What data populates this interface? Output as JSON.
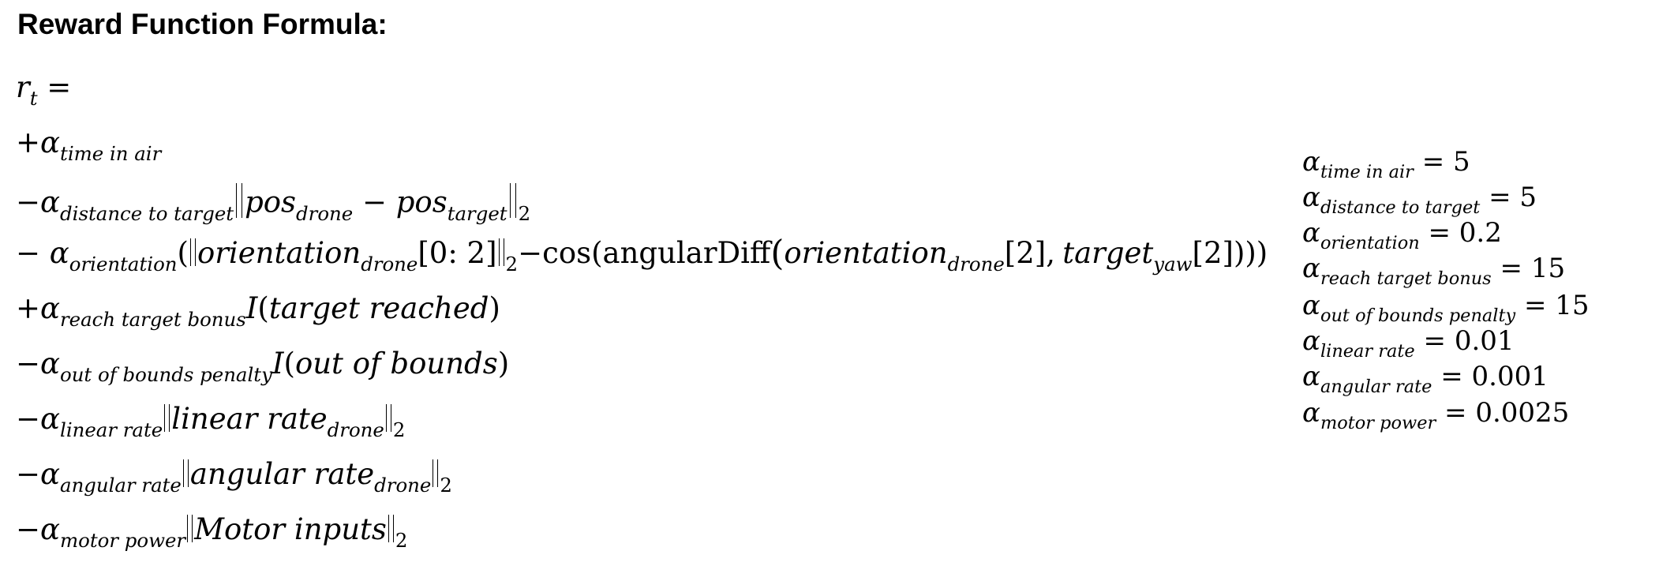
{
  "heading": "Reward Function Formula:",
  "formula": {
    "reward": {
      "symbol": "r",
      "subscript": "t",
      "equals": "="
    },
    "alpha": "α",
    "time_in_air": {
      "sign": "+",
      "subscript": "time in air"
    },
    "distance": {
      "sign": "−",
      "subscript": "distance to target",
      "pos": "pos",
      "drone": "drone",
      "minus": "−",
      "target": "target",
      "norm": "2"
    },
    "orientation": {
      "sign": "−",
      "subscript": "orientation",
      "open_paren": "(",
      "orient": "orientation",
      "drone": "drone",
      "slice": "[0: 2]",
      "norm": "2",
      "minus": "−",
      "cos": "cos",
      "fn": "angularDiff",
      "orient2": "orientation",
      "drone2": "drone",
      "idx": "[2],",
      "target": "target",
      "yaw": "yaw",
      "idx2": "[2]",
      "close": ")))"
    },
    "reach_target": {
      "sign": "+",
      "subscript": "reach target bonus",
      "indicator": "I",
      "open": "(",
      "arg": "target reached",
      "close": ")"
    },
    "out_of_bounds": {
      "sign": "−",
      "subscript": "out of bounds penalty",
      "indicator": "I",
      "open": "(",
      "arg": "out of bounds",
      "close": ")"
    },
    "linear_rate": {
      "sign": "−",
      "subscript": "linear rate",
      "arg": "linear rate",
      "drone": "drone",
      "norm": "2"
    },
    "angular_rate": {
      "sign": "−",
      "subscript": "angular rate",
      "arg": "angular rate",
      "drone": "drone",
      "norm": "2"
    },
    "motor_power": {
      "sign": "−",
      "subscript": "motor power",
      "arg": "Motor inputs",
      "norm": "2"
    }
  },
  "parameters": [
    {
      "symbol": "α",
      "subscript": "time in air",
      "equals": "=",
      "value": "5"
    },
    {
      "symbol": "α",
      "subscript": "distance to target",
      "equals": "=",
      "value": "5"
    },
    {
      "symbol": "α",
      "subscript": "orientation",
      "equals": "=",
      "value": "0.2"
    },
    {
      "symbol": "α",
      "subscript": "reach target bonus",
      "equals": "=",
      "value": "15"
    },
    {
      "symbol": "α",
      "subscript": "out of bounds penalty",
      "equals": "=",
      "value": "15"
    },
    {
      "symbol": "α",
      "subscript": "linear rate",
      "equals": "=",
      "value": "0.01"
    },
    {
      "symbol": "α",
      "subscript": "angular rate",
      "equals": "=",
      "value": "0.001"
    },
    {
      "symbol": "α",
      "subscript": "motor power",
      "equals": "=",
      "value": "0.0025"
    }
  ]
}
